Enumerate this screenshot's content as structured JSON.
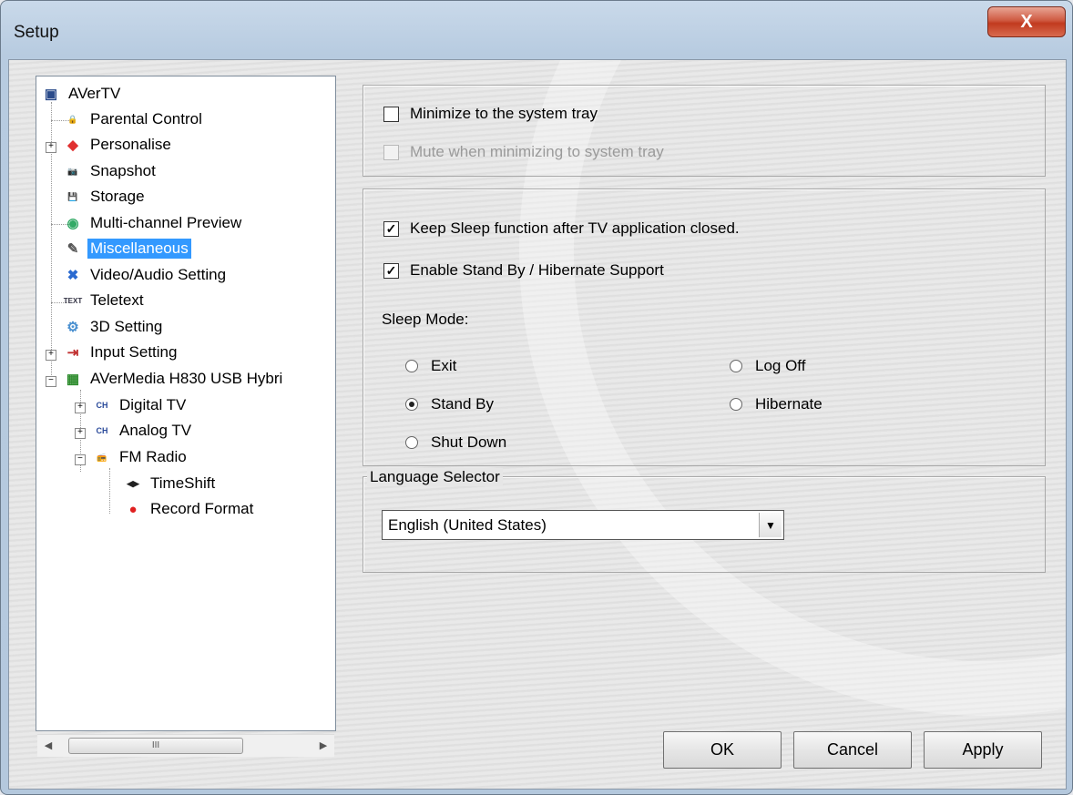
{
  "window": {
    "title": "Setup",
    "close_glyph": "X"
  },
  "tree": {
    "items": [
      {
        "label": "AVerTV",
        "icon": "avertv-icon",
        "glyph": "▣",
        "color": "#2a4a8a",
        "selected": false
      },
      {
        "label": "Parental Control",
        "icon": "lock-icon",
        "glyph": "🔒",
        "color": "#f0b020",
        "selected": false
      },
      {
        "label": "Personalise",
        "icon": "personalise-icon",
        "glyph": "◆",
        "color": "#e03030",
        "selected": false
      },
      {
        "label": "Snapshot",
        "icon": "camera-icon",
        "glyph": "📷",
        "color": "#777",
        "selected": false
      },
      {
        "label": "Storage",
        "icon": "floppy-disk-icon",
        "glyph": "💾",
        "color": "#223",
        "selected": false
      },
      {
        "label": "Multi-channel Preview",
        "icon": "eye-icon",
        "glyph": "◉",
        "color": "#3a6",
        "selected": false
      },
      {
        "label": "Miscellaneous",
        "icon": "wrench-pencil-icon",
        "glyph": "✎",
        "color": "#555",
        "selected": true
      },
      {
        "label": "Video/Audio Setting",
        "icon": "tools-icon",
        "glyph": "✖",
        "color": "#2a6ad0",
        "selected": false
      },
      {
        "label": "Teletext",
        "icon": "text-icon",
        "glyph": "TEXT",
        "color": "#334",
        "selected": false
      },
      {
        "label": "3D Setting",
        "icon": "gear-icon",
        "glyph": "⚙",
        "color": "#4a90d0",
        "selected": false
      },
      {
        "label": "Input Setting",
        "icon": "input-icon",
        "glyph": "⇥",
        "color": "#c03030",
        "selected": false
      },
      {
        "label": "AVerMedia H830 USB Hybri",
        "icon": "chip-icon",
        "glyph": "▦",
        "color": "#2a8a2a",
        "selected": false
      },
      {
        "label": "Digital TV",
        "icon": "digital-tv-icon",
        "glyph": "CH",
        "color": "#2a4a9a",
        "selected": false
      },
      {
        "label": "Analog TV",
        "icon": "analog-tv-icon",
        "glyph": "CH",
        "color": "#2a4a9a",
        "selected": false
      },
      {
        "label": "FM Radio",
        "icon": "radio-icon",
        "glyph": "📻",
        "color": "#333",
        "selected": false
      },
      {
        "label": "TimeShift",
        "icon": "timeshift-icon",
        "glyph": "◀▶",
        "color": "#222",
        "selected": false
      },
      {
        "label": "Record Format",
        "icon": "record-icon",
        "glyph": "●",
        "color": "#e02020",
        "selected": false
      }
    ],
    "scroll_left": "◀",
    "scroll_right": "▶",
    "scroll_thumb": "III"
  },
  "tray": {
    "minimize_label": "Minimize to the system tray",
    "minimize_checked": false,
    "mute_label": "Mute when minimizing to system tray",
    "mute_checked": false
  },
  "sleep": {
    "keep_label": "Keep Sleep function after TV application closed.",
    "keep_checked": true,
    "standby_label": "Enable Stand By / Hibernate Support",
    "standby_checked": true,
    "mode_label": "Sleep Mode:",
    "check_glyph": "✓",
    "options": [
      {
        "label": "Exit",
        "selected": false
      },
      {
        "label": "Log Off",
        "selected": false
      },
      {
        "label": "Stand By",
        "selected": true
      },
      {
        "label": "Hibernate",
        "selected": false
      },
      {
        "label": "Shut Down",
        "selected": false
      }
    ]
  },
  "language": {
    "legend": "Language Selector",
    "selected": "English (United States)",
    "caret": "▼"
  },
  "buttons": {
    "ok": "OK",
    "cancel": "Cancel",
    "apply": "Apply"
  }
}
